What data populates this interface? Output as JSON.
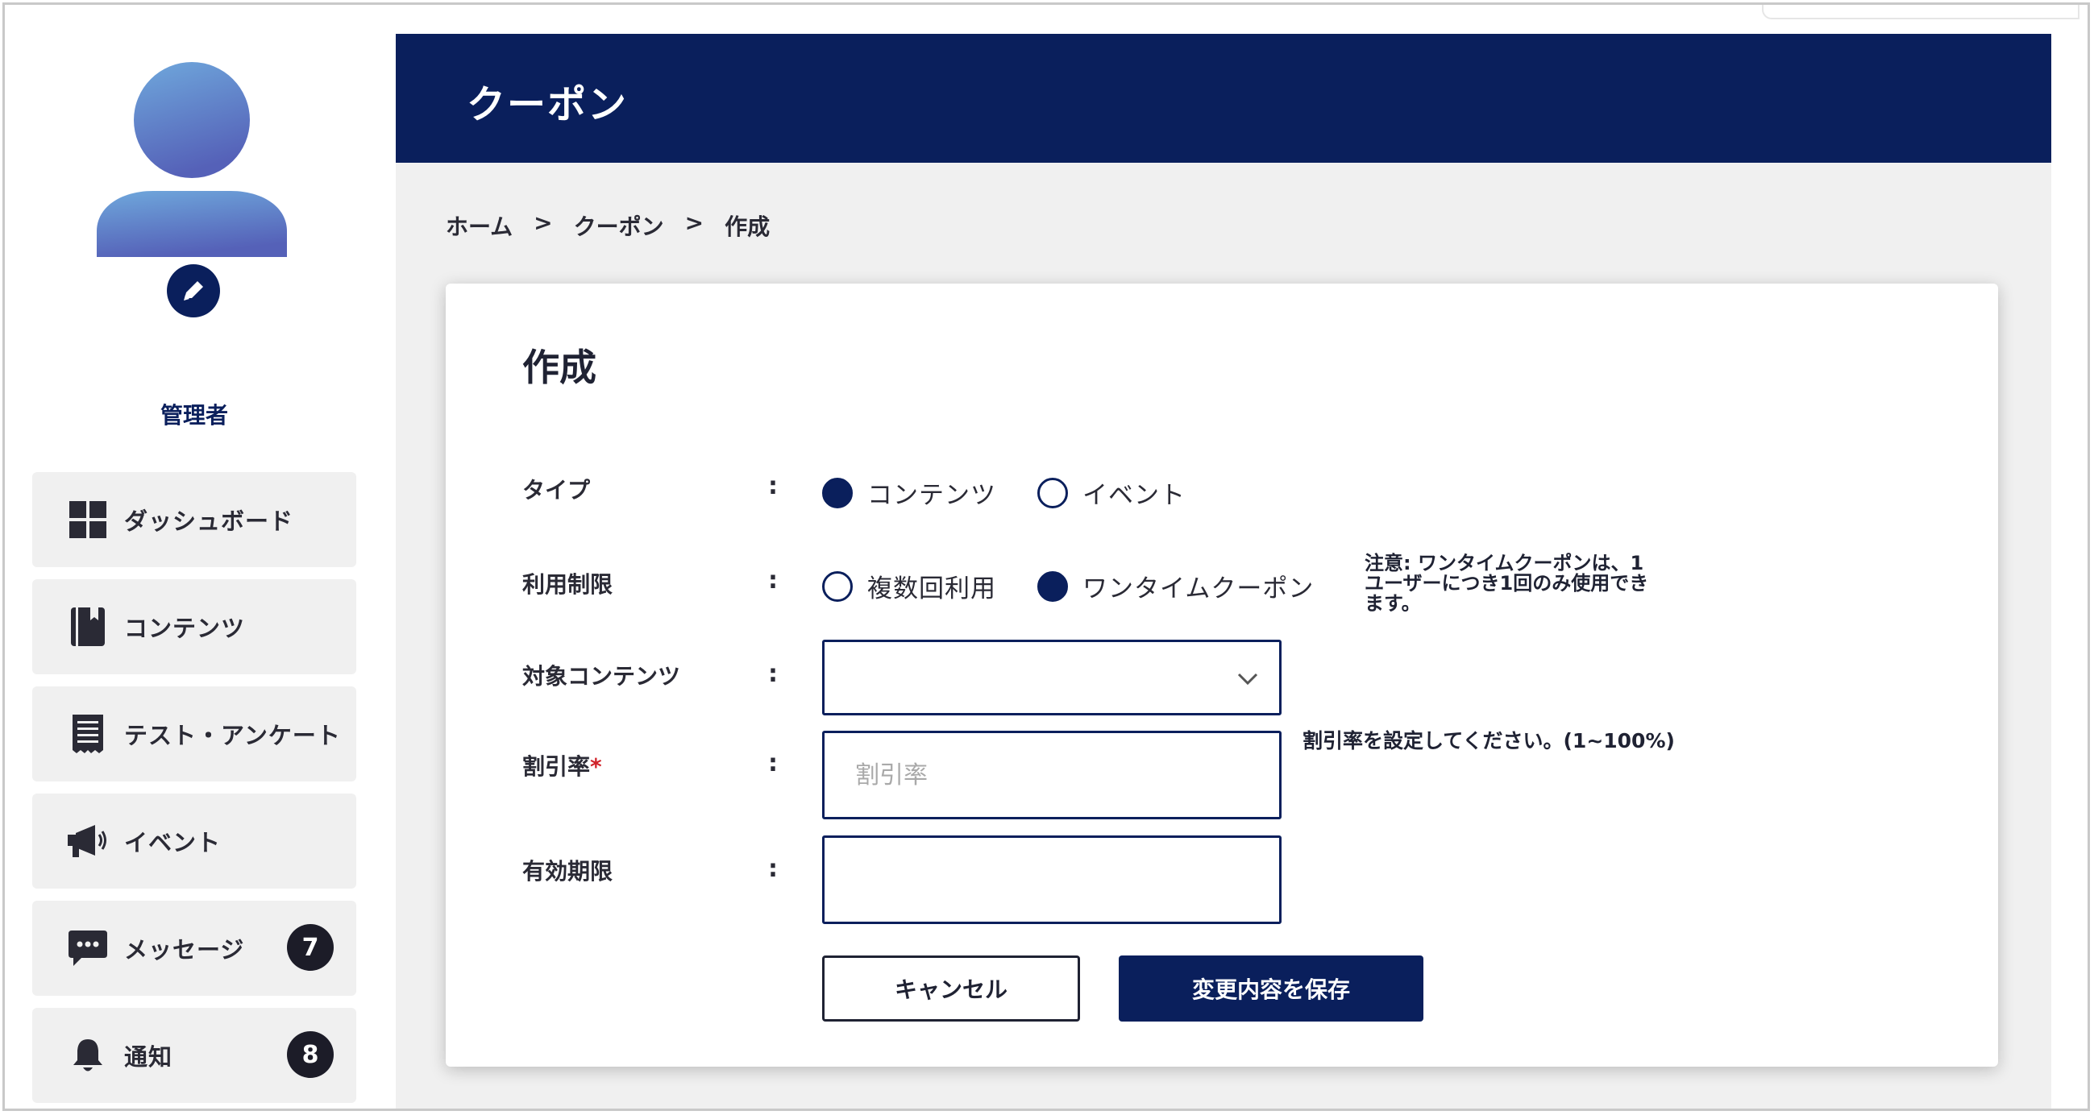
{
  "sidebar": {
    "role": "管理者",
    "items": [
      {
        "label": "ダッシュボード",
        "icon": "dashboard-grid-icon"
      },
      {
        "label": "コンテンツ",
        "icon": "book-icon"
      },
      {
        "label": "テスト・アンケート",
        "icon": "receipt-icon"
      },
      {
        "label": "イベント",
        "icon": "megaphone-icon"
      },
      {
        "label": "メッセージ",
        "icon": "chat-bubble-icon",
        "count": "7"
      },
      {
        "label": "通知",
        "icon": "bell-icon",
        "count": "8"
      }
    ]
  },
  "header": {
    "title": "クーポン"
  },
  "breadcrumb": {
    "home": "ホーム",
    "sep": ">",
    "coupon": "クーポン",
    "current": "作成"
  },
  "form": {
    "title": "作成",
    "colon": ":",
    "type": {
      "label": "タイプ",
      "options": [
        "コンテンツ",
        "イベント"
      ],
      "selected": "コンテンツ"
    },
    "usage": {
      "label": "利用制限",
      "options": [
        "複数回利用",
        "ワンタイムクーポン"
      ],
      "selected": "ワンタイムクーポン",
      "note": "注意: ワンタイムクーポンは、1ユーザーにつき1回のみ使用できます。"
    },
    "target": {
      "label": "対象コンテンツ",
      "value": ""
    },
    "discount": {
      "label": "割引率",
      "required_mark": "*",
      "placeholder": "割引率",
      "hint": "割引率を設定してください。(1~100%)"
    },
    "expiry": {
      "label": "有効期限",
      "value": ""
    },
    "cancel_label": "キャンセル",
    "save_label": "変更内容を保存"
  },
  "colors": {
    "primary": "#0a1f5c",
    "background": "#f0f0f0",
    "required": "#d0242b"
  }
}
